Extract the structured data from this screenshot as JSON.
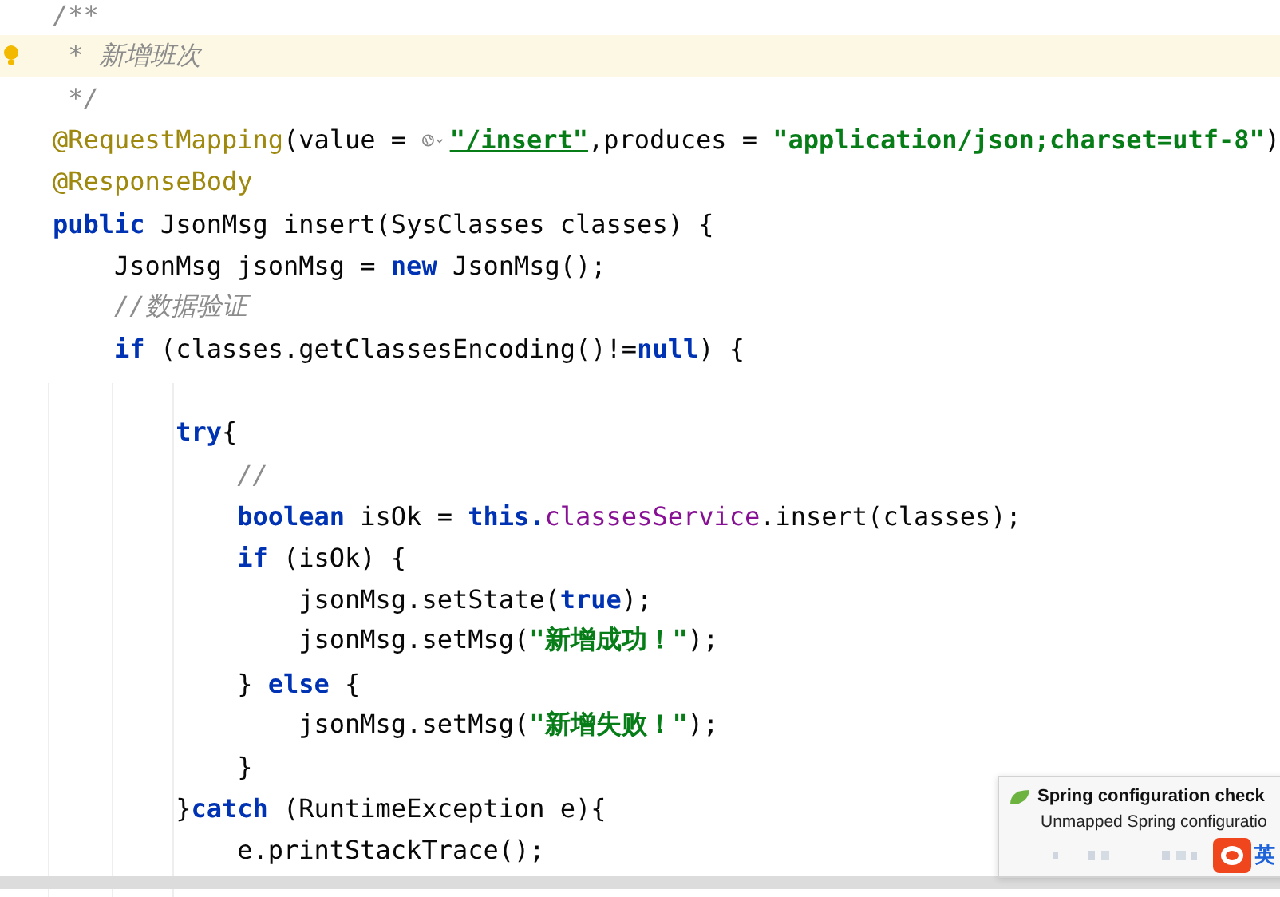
{
  "editor": {
    "lines": [
      {
        "current": false,
        "tokens": [
          {
            "kind": "comment",
            "text": "/**"
          }
        ]
      },
      {
        "current": true,
        "tokens": [
          {
            "kind": "comment",
            "text": " * 新增班次"
          }
        ]
      },
      {
        "current": false,
        "tokens": [
          {
            "kind": "comment",
            "text": " */"
          }
        ]
      },
      {
        "current": false,
        "tokens": [
          {
            "kind": "annotation",
            "text": "@RequestMapping"
          },
          {
            "kind": "plain",
            "text": "(value = "
          },
          {
            "kind": "web-icon"
          },
          {
            "kind": "link",
            "text": "\"/insert\""
          },
          {
            "kind": "plain",
            "text": ",produces = "
          },
          {
            "kind": "string",
            "text": "\"application/json;charset=utf-8\""
          },
          {
            "kind": "plain",
            "text": ")"
          }
        ]
      },
      {
        "current": false,
        "tokens": [
          {
            "kind": "annotation",
            "text": "@ResponseBody"
          }
        ]
      },
      {
        "current": false,
        "tokens": [
          {
            "kind": "keyword",
            "text": "public "
          },
          {
            "kind": "plain",
            "text": "JsonMsg insert(SysClasses classes) {"
          }
        ]
      },
      {
        "current": false,
        "tokens": [
          {
            "kind": "plain",
            "text": "    JsonMsg jsonMsg = "
          },
          {
            "kind": "keyword",
            "text": "new "
          },
          {
            "kind": "plain",
            "text": "JsonMsg();"
          }
        ]
      },
      {
        "current": false,
        "tokens": [
          {
            "kind": "comment",
            "text": "    //数据验证"
          }
        ]
      },
      {
        "current": false,
        "tokens": [
          {
            "kind": "keyword",
            "text": "    if "
          },
          {
            "kind": "plain",
            "text": "(classes.getClassesEncoding()!="
          },
          {
            "kind": "keyword",
            "text": "null"
          },
          {
            "kind": "plain",
            "text": ") {"
          }
        ]
      },
      {
        "current": false
      },
      {
        "current": false,
        "tokens": [
          {
            "kind": "keyword",
            "text": "        try"
          },
          {
            "kind": "plain",
            "text": "{"
          }
        ]
      },
      {
        "current": false,
        "tokens": [
          {
            "kind": "comment",
            "text": "            //"
          }
        ]
      },
      {
        "current": false,
        "tokens": [
          {
            "kind": "keyword",
            "text": "            boolean "
          },
          {
            "kind": "plain",
            "text": "isOk = "
          },
          {
            "kind": "keyword",
            "text": "this."
          },
          {
            "kind": "field",
            "text": "classesService"
          },
          {
            "kind": "plain",
            "text": ".insert(classes);"
          }
        ]
      },
      {
        "current": false,
        "tokens": [
          {
            "kind": "keyword",
            "text": "            if "
          },
          {
            "kind": "plain",
            "text": "(isOk) {"
          }
        ]
      },
      {
        "current": false,
        "tokens": [
          {
            "kind": "plain",
            "text": "                jsonMsg.setState("
          },
          {
            "kind": "keyword",
            "text": "true"
          },
          {
            "kind": "plain",
            "text": ");"
          }
        ]
      },
      {
        "current": false,
        "tokens": [
          {
            "kind": "plain",
            "text": "                jsonMsg.setMsg("
          },
          {
            "kind": "string",
            "text": "\"新增成功！\""
          },
          {
            "kind": "plain",
            "text": ");"
          }
        ]
      },
      {
        "current": false,
        "tokens": [
          {
            "kind": "plain",
            "text": "            } "
          },
          {
            "kind": "keyword",
            "text": "else "
          },
          {
            "kind": "plain",
            "text": "{"
          }
        ]
      },
      {
        "current": false,
        "tokens": [
          {
            "kind": "plain",
            "text": "                jsonMsg.setMsg("
          },
          {
            "kind": "string",
            "text": "\"新增失败！\""
          },
          {
            "kind": "plain",
            "text": ");"
          }
        ]
      },
      {
        "current": false,
        "tokens": [
          {
            "kind": "plain",
            "text": "            }"
          }
        ]
      },
      {
        "current": false,
        "tokens": [
          {
            "kind": "plain",
            "text": "        }"
          },
          {
            "kind": "keyword",
            "text": "catch "
          },
          {
            "kind": "plain",
            "text": "(RuntimeException e){"
          }
        ]
      },
      {
        "current": false,
        "tokens": [
          {
            "kind": "plain",
            "text": "            e.printStackTrace();"
          }
        ]
      }
    ]
  },
  "notification": {
    "title": "Spring configuration check",
    "body": "Unmapped Spring configuratio",
    "ime_label": "英"
  }
}
